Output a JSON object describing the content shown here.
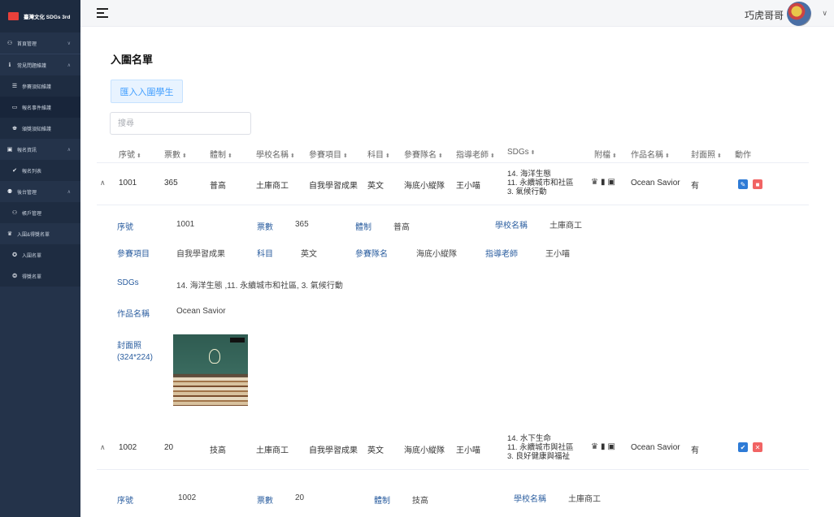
{
  "sidebar": {
    "brand": "臺灣文化 SDGs 3rd",
    "items": [
      {
        "label": "首頁管理",
        "icon": "sitemap-icon",
        "chevron": "∨"
      },
      {
        "label": "常見問題維護",
        "icon": "info-icon",
        "chevron": "∧"
      },
      {
        "label": "參賽須知維護",
        "icon": "list-icon",
        "sub": true
      },
      {
        "label": "報名事件維護",
        "icon": "folder-icon",
        "sub": true,
        "active": true
      },
      {
        "label": "頒獎須知維護",
        "icon": "trophy-icon",
        "sub": true
      },
      {
        "label": "報名資訊",
        "icon": "document-icon",
        "chevron": "∧"
      },
      {
        "label": "報名列表",
        "icon": "check-icon",
        "sub": true
      },
      {
        "label": "後台管理",
        "icon": "users-icon",
        "chevron": "∧"
      },
      {
        "label": "帳戶管理",
        "icon": "user-add-icon",
        "sub": true
      },
      {
        "label": "入圍&得獎名單",
        "icon": "crown-icon"
      },
      {
        "label": "入圍名單",
        "icon": "award-icon",
        "sub": true
      },
      {
        "label": "得獎名單",
        "icon": "medal-icon",
        "sub": true
      }
    ]
  },
  "topbar": {
    "user": "巧虎哥哥",
    "user_chevron": "∨"
  },
  "page": {
    "title": "入圍名單",
    "import_label": "匯入入圍學生",
    "search_placeholder": "搜尋"
  },
  "table": {
    "headers": [
      "序號",
      "票數",
      "體制",
      "學校名稱",
      "參賽項目",
      "科目",
      "參賽隊名",
      "指導老師",
      "SDGs",
      "附檔",
      "作品名稱",
      "封面照",
      "動作"
    ],
    "sort_glyph": "⬍",
    "rows": [
      {
        "id": "1001",
        "votes": "365",
        "system": "普高",
        "school": "土庫商工",
        "category": "自我學習成果",
        "subject": "英文",
        "team": "海底小縱隊",
        "teacher": "王小喵",
        "sdgs": [
          "14. 海洋生態",
          "11. 永續城市和社區",
          "3. 氣候行動"
        ],
        "work": "Ocean Savior",
        "cover": "有"
      },
      {
        "id": "1002",
        "votes": "20",
        "system": "技高",
        "school": "土庫商工",
        "category": "自我學習成果",
        "subject": "英文",
        "team": "海底小縱隊",
        "teacher": "王小喵",
        "sdgs": [
          "14. 水下生命",
          "11. 永續城市與社區",
          "3. 良好健康與福祉"
        ],
        "work": "Ocean Savior",
        "cover": "有"
      }
    ]
  },
  "detail1": {
    "labels": {
      "id": "序號",
      "votes": "票數",
      "system": "體制",
      "school": "學校名稱",
      "category": "參賽項目",
      "subject": "科目",
      "team": "參賽隊名",
      "teacher": "指導老師",
      "sdgs": "SDGs",
      "work": "作品名稱",
      "cover": "封面照",
      "cover_size": "(324*224)"
    },
    "values": {
      "id": "1001",
      "votes": "365",
      "system": "普高",
      "school": "土庫商工",
      "category": "自我學習成果",
      "subject": "英文",
      "team": "海底小縱隊",
      "teacher": "王小喵",
      "sdgs": "14. 海洋生態 ,11. 永續城市和社區, 3. 氣候行動",
      "work": "Ocean Savior"
    }
  },
  "detail2": {
    "labels": {
      "id": "序號",
      "votes": "票數",
      "system": "體制",
      "school": "學校名稱"
    },
    "values": {
      "id": "1002",
      "votes": "20",
      "system": "技高",
      "school": "土庫商工"
    }
  },
  "glyphs": {
    "expand": "∧",
    "trophy": "🏆",
    "file": "▮",
    "film": "▣",
    "edit": "✎",
    "delete": "🗑",
    "close": "✕"
  }
}
